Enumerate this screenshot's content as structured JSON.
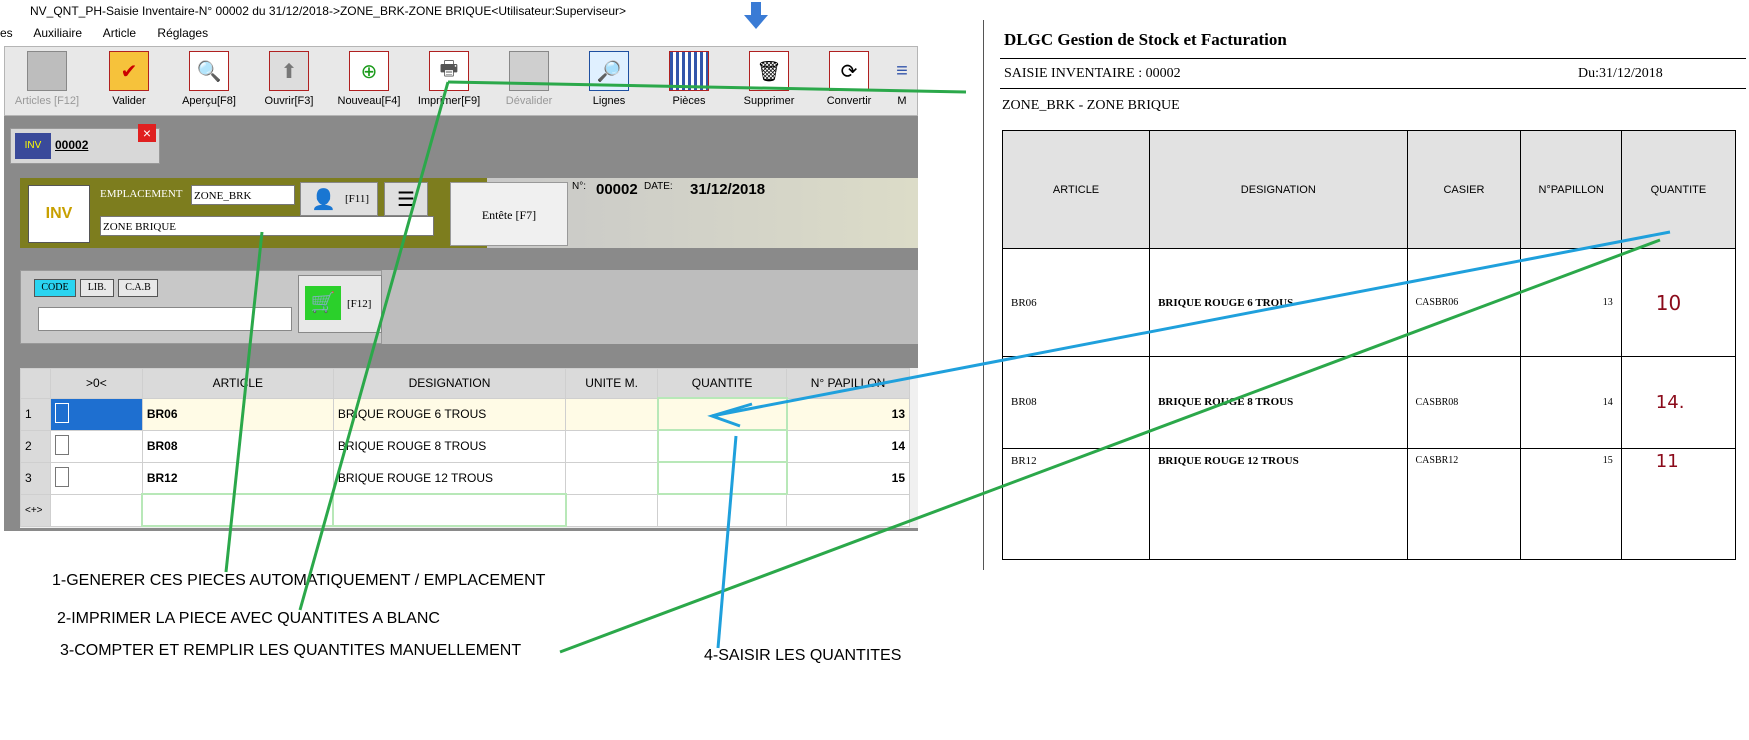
{
  "window": {
    "title": "NV_QNT_PH-Saisie Inventaire-N° 00002 du 31/12/2018->ZONE_BRK-ZONE BRIQUE<Utilisateur:Superviseur>",
    "menu": [
      "es",
      "Auxiliaire",
      "Article",
      "Réglages"
    ]
  },
  "toolbar": [
    {
      "label": "Articles [F12]",
      "icon": "articles-icon",
      "disabled": true
    },
    {
      "label": "Valider",
      "icon": "checkmark-icon",
      "disabled": false
    },
    {
      "label": "Aperçu[F8]",
      "icon": "magnifier-icon",
      "disabled": false
    },
    {
      "label": "Ouvrir[F3]",
      "icon": "up-arrow-icon",
      "disabled": false
    },
    {
      "label": "Nouveau[F4]",
      "icon": "plus-icon",
      "disabled": false
    },
    {
      "label": "Imprimer[F9]",
      "icon": "printer-icon",
      "disabled": false
    },
    {
      "label": "Dévalider",
      "icon": "monitor-icon",
      "disabled": true
    },
    {
      "label": "Lignes",
      "icon": "search-icon",
      "disabled": false
    },
    {
      "label": "Pièces",
      "icon": "grid-icon",
      "disabled": false
    },
    {
      "label": "Supprimer",
      "icon": "trash-icon",
      "disabled": false
    },
    {
      "label": "Convertir",
      "icon": "convert-icon",
      "disabled": false
    },
    {
      "label": "M",
      "icon": "more-icon",
      "disabled": false
    }
  ],
  "doc_tab": {
    "number": "00002",
    "close": "×"
  },
  "header": {
    "emplacement_label": "EMPLACEMENT",
    "emplacement_value": "ZONE_BRK",
    "zone_name": "ZONE BRIQUE",
    "f11": "[F11]",
    "entete_button": "Entête [F7]",
    "n_label": "N°:",
    "number": "00002",
    "date_label": "DATE:",
    "date": "31/12/2018"
  },
  "search": {
    "tabs": [
      "CODE",
      "LIB.",
      "C.A.B"
    ],
    "input_value": "",
    "f12": "[F12]"
  },
  "grid": {
    "columns": [
      ">0<",
      "ARTICLE",
      "DESIGNATION",
      "UNITE M.",
      "QUANTITE",
      "N° PAPILLON"
    ],
    "rows": [
      {
        "num": "1",
        "article": "BR06",
        "designation": "BRIQUE ROUGE 6 TROUS",
        "unite": "",
        "quantite": "",
        "papillon": "13"
      },
      {
        "num": "2",
        "article": "BR08",
        "designation": "BRIQUE ROUGE 8 TROUS",
        "unite": "",
        "quantite": "",
        "papillon": "14"
      },
      {
        "num": "3",
        "article": "BR12",
        "designation": "BRIQUE ROUGE 12 TROUS",
        "unite": "",
        "quantite": "",
        "papillon": "15"
      }
    ],
    "new_row_marker": "<+>"
  },
  "paper": {
    "company": "DLGC Gestion de Stock et Facturation",
    "title": "SAISIE INVENTAIRE : 00002",
    "date": "Du:31/12/2018",
    "zone": "ZONE_BRK - ZONE BRIQUE",
    "columns": [
      "ARTICLE",
      "DESIGNATION",
      "CASIER",
      "N°PAPILLON",
      "QUANTITE"
    ],
    "rows": [
      {
        "article": "BR06",
        "designation": "BRIQUE ROUGE 6 TROUS",
        "casier": "CASBR06",
        "papillon": "13",
        "quantite": "10"
      },
      {
        "article": "BR08",
        "designation": "BRIQUE ROUGE 8 TROUS",
        "casier": "CASBR08",
        "papillon": "14",
        "quantite": "14."
      },
      {
        "article": "BR12",
        "designation": "BRIQUE ROUGE 12 TROUS",
        "casier": "CASBR12",
        "papillon": "15",
        "quantite": "11"
      }
    ]
  },
  "notes": {
    "n1": "1-GENERER CES PIECES AUTOMATIQUEMENT / EMPLACEMENT",
    "n2": "2-IMPRIMER LA PIECE AVEC QUANTITES A BLANC",
    "n3": "3-COMPTER ET REMPLIR LES QUANTITES MANUELLEMENT",
    "n4": "4-SAISIR LES QUANTITES"
  },
  "colors": {
    "green_line": "#2ba84a",
    "blue_line": "#1fa0dc",
    "olive": "#7d7d1e",
    "handwriting": "#8b0a1a"
  }
}
